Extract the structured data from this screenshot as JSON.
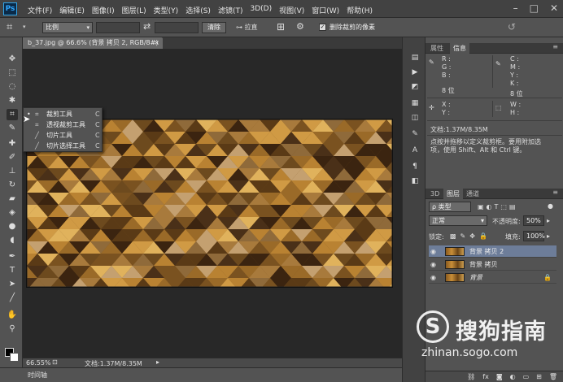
{
  "app": {
    "logo": "Ps"
  },
  "menu": [
    "文件(F)",
    "编辑(E)",
    "图像(I)",
    "图层(L)",
    "类型(Y)",
    "选择(S)",
    "滤镜(T)",
    "3D(D)",
    "视图(V)",
    "窗口(W)",
    "帮助(H)"
  ],
  "window_controls": {
    "minimize": "–",
    "restore": "□",
    "close": "✕"
  },
  "options": {
    "ratio_value": "比例",
    "clear_label": "清除",
    "straighten_label": "拉直",
    "delete_pixels_label": "删除裁剪的像素",
    "delete_pixels_checked": true
  },
  "document": {
    "tab_title": "b_37.jpg @ 66.6% (背景 拷贝 2, RGB/8#) *",
    "zoom": "66.55%",
    "doc_info": "文档:1.37M/8.35M",
    "timeline_label": "时间轴"
  },
  "crop_flyout": {
    "items": [
      {
        "label": "裁剪工具",
        "key": "C",
        "selected": true
      },
      {
        "label": "透视裁剪工具",
        "key": "C",
        "selected": false
      },
      {
        "label": "切片工具",
        "key": "C",
        "selected": false
      },
      {
        "label": "切片选择工具",
        "key": "C",
        "selected": false
      }
    ]
  },
  "info_panel": {
    "tabs": [
      "属性",
      "信息"
    ],
    "active_tab": "信息",
    "rgb": [
      "R :",
      "G :",
      "B :"
    ],
    "cmyk": [
      "C :",
      "M :",
      "Y :",
      "K :"
    ],
    "bit_left": "8 位",
    "bit_right": "8 位",
    "xy": [
      "X :",
      "Y :"
    ],
    "wh": [
      "W :",
      "H :"
    ],
    "doc": "文档:1.37M/8.35M",
    "hint": "点按并拖移以定义裁剪框。要用附加选项，使用 Shift、Alt 和 Ctrl 键。"
  },
  "layers_panel": {
    "tabs": [
      "3D",
      "图层",
      "通道"
    ],
    "active_tab": "图层",
    "filter_kind": "ρ 类型",
    "blend_mode": "正常",
    "opacity_label": "不透明度:",
    "opacity_value": "50%",
    "lock_label": "锁定:",
    "fill_label": "填充:",
    "fill_value": "100%",
    "layers": [
      {
        "name": "背景 拷贝 2",
        "selected": true,
        "locked": false
      },
      {
        "name": "背景 拷贝",
        "selected": false,
        "locked": false
      },
      {
        "name": "背景",
        "selected": false,
        "locked": true
      }
    ],
    "footer_icons": [
      "link-icon",
      "fx-icon",
      "mask-icon",
      "adjustment-icon",
      "group-icon",
      "new-layer-icon",
      "trash-icon"
    ]
  },
  "watermark": {
    "brand": "搜狗指南",
    "url": "zhinan.sogo.com",
    "logo_letter": "S"
  }
}
